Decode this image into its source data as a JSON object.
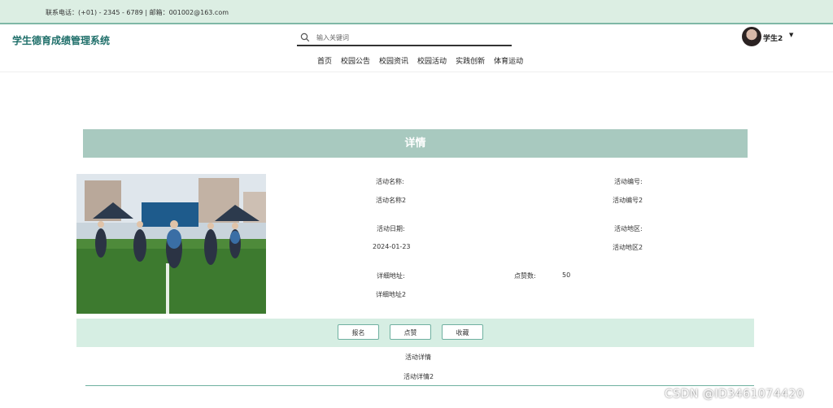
{
  "topbar": {
    "contact": "联系电话：(+01) - 2345 - 6789 | 邮箱：001002@163.com"
  },
  "header": {
    "site_title": "学生德育成绩管理系统",
    "search_placeholder": "输入关键词",
    "user_name": "学生2",
    "caret": "▼",
    "nav": [
      "首页",
      "校园公告",
      "校园资讯",
      "校园活动",
      "实践创新",
      "体育运动"
    ]
  },
  "detail": {
    "title": "详情",
    "fields": {
      "activity_name": {
        "label": "活动名称:",
        "value": "活动名称2"
      },
      "activity_no": {
        "label": "活动编号:",
        "value": "活动编号2"
      },
      "activity_date": {
        "label": "活动日期:",
        "value": "2024-01-23"
      },
      "activity_area": {
        "label": "活动地区:",
        "value": "活动地区2"
      },
      "address": {
        "label": "详细地址:",
        "value": "详细地址2"
      },
      "likes": {
        "label": "点赞数:",
        "value": "50"
      }
    },
    "buttons": {
      "signup": "报名",
      "like": "点赞",
      "favorite": "收藏"
    },
    "section_heading": "活动详情",
    "section_body": "活动详情2"
  },
  "watermark": "CSDN @ID3461074420"
}
